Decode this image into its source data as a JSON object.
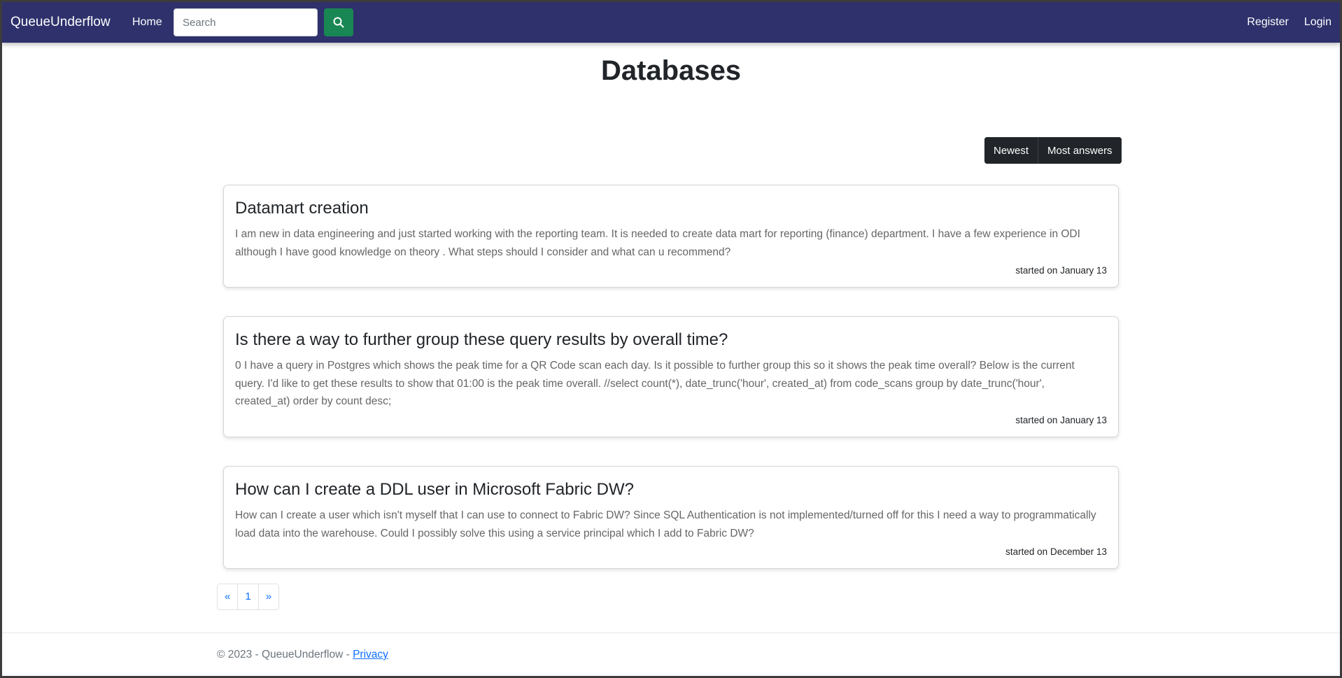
{
  "navbar": {
    "brand": "QueueUnderflow",
    "home_label": "Home",
    "search_placeholder": "Search",
    "register_label": "Register",
    "login_label": "Login"
  },
  "page": {
    "title": "Databases"
  },
  "sort": {
    "newest_label": "Newest",
    "most_answers_label": "Most answers"
  },
  "questions": [
    {
      "title": "Datamart creation",
      "body": "I am new in data engineering and just started working with the reporting team. It is needed to create data mart for reporting (finance) department. I have a few experience in ODI although I have good knowledge on theory . What steps should I consider and what can u recommend?",
      "meta": "started on January 13"
    },
    {
      "title": "Is there a way to further group these query results by overall time?",
      "body": "0 I have a query in Postgres which shows the peak time for a QR Code scan each day. Is it possible to further group this so it shows the peak time overall? Below is the current query. I'd like to get these results to show that 01:00 is the peak time overall. //select count(*), date_trunc('hour', created_at) from code_scans group by date_trunc('hour', created_at) order by count desc;",
      "meta": "started on January 13"
    },
    {
      "title": "How can I create a DDL user in Microsoft Fabric DW?",
      "body": "How can I create a user which isn't myself that I can use to connect to Fabric DW? Since SQL Authentication is not implemented/turned off for this I need a way to programmatically load data into the warehouse. Could I possibly solve this using a service principal which I add to Fabric DW?",
      "meta": "started on December 13"
    }
  ],
  "pagination": {
    "prev_label": "«",
    "current_page": "1",
    "next_label": "»"
  },
  "footer": {
    "copyright": "© 2023 - QueueUnderflow - ",
    "privacy_label": "Privacy"
  },
  "colors": {
    "navbar_bg": "#2e316b",
    "search_button": "#198754",
    "sort_buttons": "#212529",
    "link": "#0d6efd"
  },
  "icons": {
    "search_button_icon": "search-icon"
  }
}
